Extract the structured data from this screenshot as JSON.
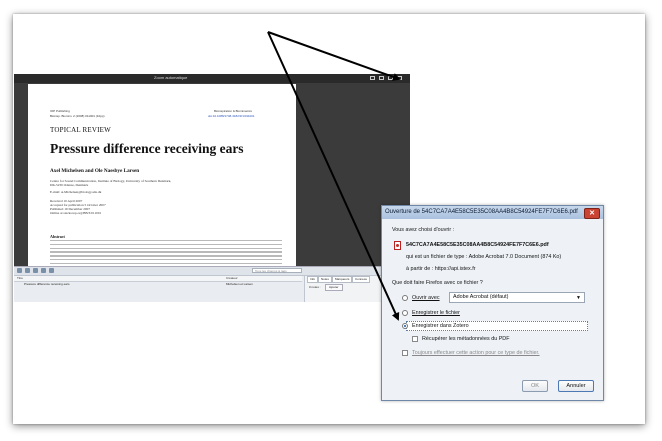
{
  "viewer": {
    "title": "Zoom automatique"
  },
  "pdf_page": {
    "journal_left": "IOP Publishing",
    "journal_ref": "Bioinsp. Biomim. 2 (2008) 011001 (10pp)",
    "journal_right": "Bioinspiration & Biomimetics",
    "doi": "doi:10.1088/1748-3182/3/1/011001",
    "section": "TOPICAL REVIEW",
    "title": "Pressure difference receiving ears",
    "authors": "Axel Michelsen and Ole Naesbye Larsen",
    "affil_1": "Centre for Sound Communication, Institute of Biology, University of Southern Denmark,",
    "affil_2": "DK-5230 Odense, Denmark",
    "email": "E-mail: A.Michelsen@biology.sdu.dk",
    "received": "Received 10 April 2007",
    "accepted": "Accepted for publication 5 October 2007",
    "published": "Published 19 December 2007",
    "online": "Online at stacks.iop.org/BB/3/011001",
    "abstract_heading": "Abstract"
  },
  "zotero": {
    "search_placeholder": "Tous les champs & tags",
    "col_title": "Titre",
    "col_creator": "Créateur",
    "row_title": "Pressure difference receiving ears",
    "row_creator": "Michelsen et Larsen",
    "tab_info": "Info",
    "tab_notes": "Notes",
    "tab_tags": "Marqueurs",
    "tab_related": "Connexe",
    "notes_count": "0 notes :",
    "add_btn": "Ajouter"
  },
  "dialog": {
    "title": "Ouverture de 54C7CA7A4E58C5E35C08AA4B8C54924FE7F7C6E6.pdf",
    "close": "✕",
    "intro": "Vous avez choisi d'ouvrir :",
    "filename": "54C7CA7A4E58C5E35C08AA4B8C54924FE7F7C6E6.pdf",
    "filetype": "qui est un fichier de type : Adobe Acrobat 7.0 Document (874 Ko)",
    "source": "à partir de : https://api.istex.fr",
    "question": "Que doit faire Firefox avec ce fichier ?",
    "open_with_label": "Ouvrir avec",
    "open_with_value": "Adobe Acrobat (défaut)",
    "save_file_label": "Enregistrer le fichier",
    "save_zotero_label": "Enregistrer dans Zotero",
    "recover_meta_label": "Récupérer les métadonnées du PDF",
    "always_label": "Toujours effectuer cette action pour ce type de fichier.",
    "ok_label": "OK",
    "cancel_label": "Annuler",
    "selected_option": "Enregistrer dans Zotero"
  }
}
